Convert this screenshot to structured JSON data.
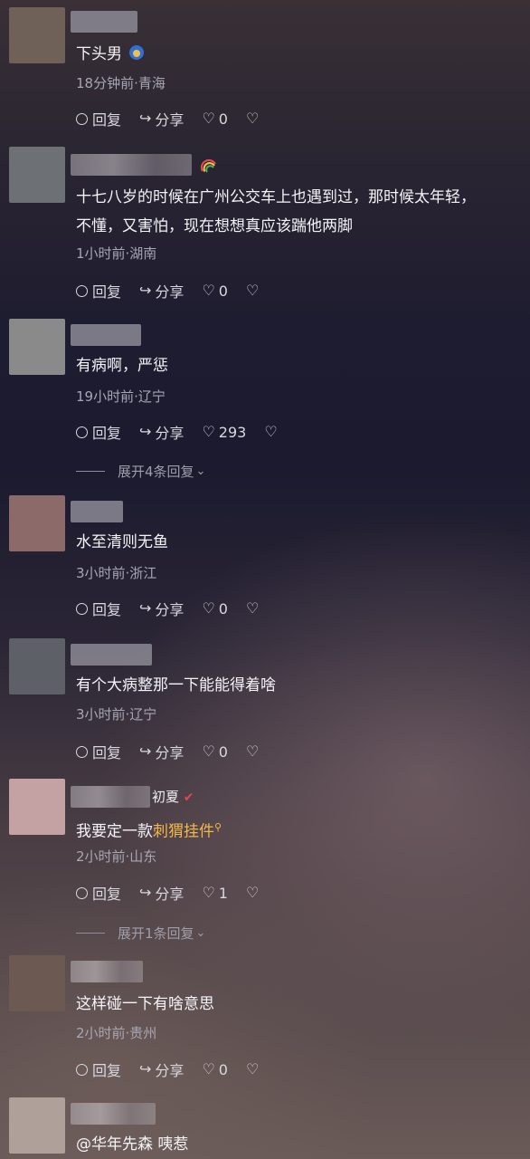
{
  "comments": [
    {
      "text": "下头男",
      "meta": "18分钟前·青海",
      "reply_label": "回复",
      "share_label": "分享",
      "like_count": "0"
    },
    {
      "text_line1": "十七八岁的时候在广州公交车上也遇到过，那时候太年轻，",
      "text_line2": "不懂，又害怕，现在想想真应该踹他两脚",
      "meta": "1小时前·湖南",
      "reply_label": "回复",
      "share_label": "分享",
      "like_count": "0"
    },
    {
      "text": "有病啊，严惩",
      "meta": "19小时前·辽宁",
      "reply_label": "回复",
      "share_label": "分享",
      "like_count": "293",
      "expand_label": "展开4条回复"
    },
    {
      "text": "水至清则无鱼",
      "meta": "3小时前·浙江",
      "reply_label": "回复",
      "share_label": "分享",
      "like_count": "0"
    },
    {
      "text": "有个大病整那一下能能得着啥",
      "meta": "3小时前·辽宁",
      "reply_label": "回复",
      "share_label": "分享",
      "like_count": "0"
    },
    {
      "name_suffix": "初夏",
      "text_prefix": "我要定一款",
      "text_highlight": "刺猬挂件",
      "meta": "2小时前·山东",
      "reply_label": "回复",
      "share_label": "分享",
      "like_count": "1",
      "expand_label": "展开1条回复"
    },
    {
      "text": "这样碰一下有啥意思",
      "meta": "2小时前·贵州",
      "reply_label": "回复",
      "share_label": "分享",
      "like_count": "0"
    },
    {
      "text": "@华年先森 咦惹"
    }
  ],
  "colors": {
    "avatar_1": "#6f6058",
    "avatar_2": "#6d7074",
    "avatar_3": "#8a8a8a",
    "avatar_4": "#8c6a6a",
    "avatar_5": "#5e6068",
    "avatar_6": "#c4a2a4",
    "avatar_7": "#6c5a52",
    "avatar_8": "#b0a09a",
    "highlight": "#f2b84a"
  },
  "icons": {
    "reply": "comment-bubble-icon",
    "share": "share-arrow-icon",
    "like": "heart-icon",
    "dislike": "broken-heart-icon",
    "badge": "rainbow-icon",
    "verified": "check-icon",
    "chevron": "chevron-down-icon"
  }
}
